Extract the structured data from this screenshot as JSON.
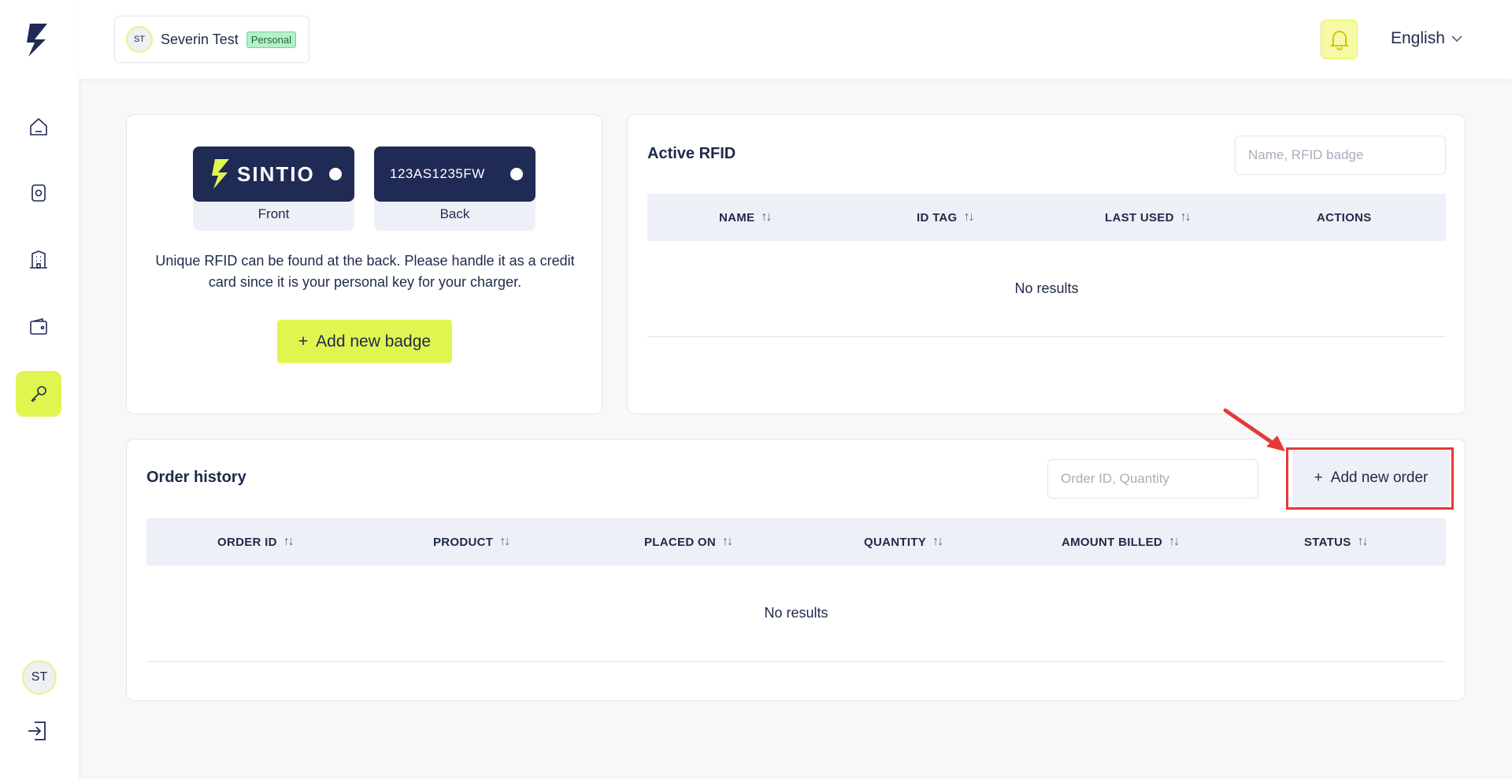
{
  "sidebar": {
    "avatar_initials": "ST",
    "items": [
      {
        "name": "home",
        "icon": "home-icon"
      },
      {
        "name": "charger",
        "icon": "charger-icon"
      },
      {
        "name": "building",
        "icon": "building-icon"
      },
      {
        "name": "wallet",
        "icon": "wallet-icon"
      },
      {
        "name": "key",
        "icon": "key-icon",
        "active": true
      }
    ]
  },
  "header": {
    "account_initials": "ST",
    "account_name": "Severin Test",
    "account_tag": "Personal",
    "language": "English"
  },
  "badge_card": {
    "front_brand": "SINTIO",
    "front_label": "Front",
    "back_serial": "123AS1235FW",
    "back_label": "Back",
    "description": "Unique RFID can be found at the back. Please handle it as a credit card since it is your personal key for your charger.",
    "add_button": "Add new badge"
  },
  "rfid_card": {
    "title": "Active RFID",
    "search_placeholder": "Name, RFID badge",
    "columns": [
      "NAME",
      "ID TAG",
      "LAST USED",
      "ACTIONS"
    ],
    "empty": "No results"
  },
  "order_card": {
    "title": "Order history",
    "search_placeholder": "Order ID, Quantity",
    "add_button": "Add new order",
    "columns": [
      "ORDER ID",
      "PRODUCT",
      "PLACED ON",
      "QUANTITY",
      "AMOUNT BILLED",
      "STATUS"
    ],
    "empty": "No results"
  },
  "colors": {
    "accent": "#e0f550",
    "navy": "#1f2a55",
    "highlight": "#e53935"
  }
}
